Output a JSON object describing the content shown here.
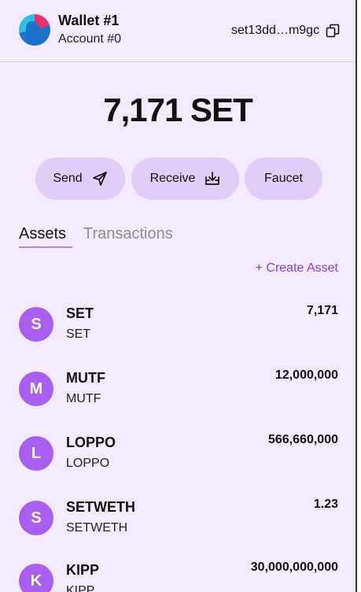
{
  "header": {
    "wallet_name": "Wallet #1",
    "account_name": "Account #0",
    "address": "set13dd…m9gc"
  },
  "balance": "7,171 SET",
  "actions": {
    "send": "Send",
    "receive": "Receive",
    "faucet": "Faucet"
  },
  "tabs": {
    "assets": "Assets",
    "transactions": "Transactions",
    "active": "Assets"
  },
  "create_asset": "+ Create Asset",
  "assets": [
    {
      "initial": "S",
      "name": "SET",
      "symbol": "SET",
      "amount": "7,171"
    },
    {
      "initial": "M",
      "name": "MUTF",
      "symbol": "MUTF",
      "amount": "12,000,000"
    },
    {
      "initial": "L",
      "name": "LOPPO",
      "symbol": "LOPPO",
      "amount": "566,660,000"
    },
    {
      "initial": "S",
      "name": "SETWETH",
      "symbol": "SETWETH",
      "amount": "1.23"
    },
    {
      "initial": "K",
      "name": "KIPP",
      "symbol": "KIPP",
      "amount": "30,000,000,000"
    }
  ],
  "colors": {
    "background": "#f3ebfd",
    "button": "#e2ccf8",
    "accent": "#8a3bd6",
    "asset_icon": "#a85ff0"
  }
}
